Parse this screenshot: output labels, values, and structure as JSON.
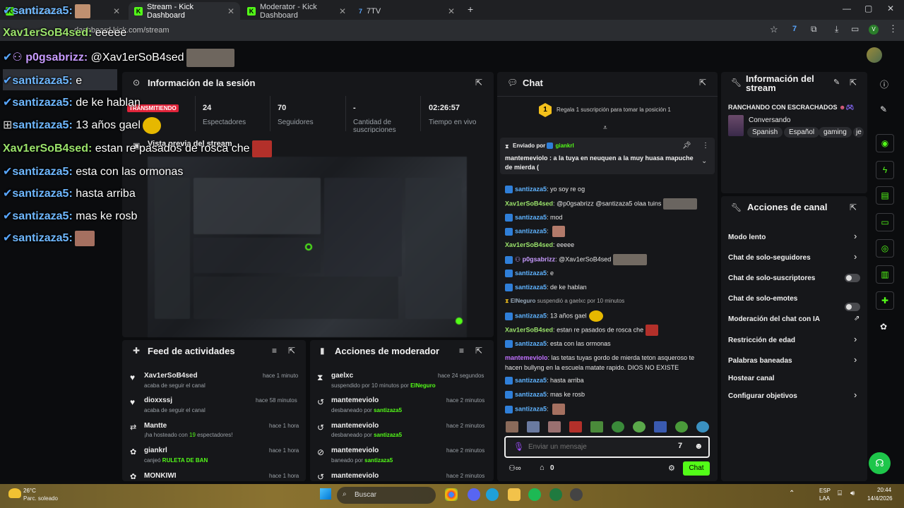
{
  "browser": {
    "tabs": [
      {
        "label": "santizaza5: ..."
      },
      {
        "label": "Stream - Kick Dashboard"
      },
      {
        "label": "Moderator - Kick Dashboard"
      },
      {
        "label": "7TV"
      }
    ],
    "url": "dashboard.kick.com/stream",
    "profile_initial": "V"
  },
  "overlay_chat": [
    {
      "user": "santizaza5:",
      "text": ""
    },
    {
      "user": "Xav1erSoB4sed:",
      "text": "eeeee"
    },
    {
      "user": "p0gsabrizz:",
      "text": "@Xav1erSoB4sed"
    },
    {
      "user": "santizaza5:",
      "text": "e"
    },
    {
      "user": "santizaza5:",
      "text": "de ke hablan"
    },
    {
      "user": "santizaza5:",
      "text": "13 años gael"
    },
    {
      "user": "Xav1erSoB4sed:",
      "text": "estan re pasados de rosca che"
    },
    {
      "user": "santizaza5:",
      "text": "esta con las ormonas"
    },
    {
      "user": "santizaza5:",
      "text": "hasta arriba"
    },
    {
      "user": "santizaza5:",
      "text": "mas ke rosb"
    },
    {
      "user": "santizaza5:",
      "text": ""
    }
  ],
  "session": {
    "title": "Información de la sesión",
    "live_badge": "TRANSMITIENDO",
    "stats": [
      {
        "value": "24",
        "label": "Espectadores"
      },
      {
        "value": "70",
        "label": "Seguidores"
      },
      {
        "value": "-",
        "label": "Cantidad de suscripciones"
      },
      {
        "value": "02:26:57",
        "label": "Tiempo en vivo"
      }
    ],
    "preview_title": "Vista previa del stream"
  },
  "activity": {
    "title": "Feed de actividades",
    "items": [
      {
        "name": "Xav1erSoB4sed",
        "sub": "acaba de seguir el canal",
        "time": "hace 1 minuto"
      },
      {
        "name": "dioxxssj",
        "sub": "acaba de seguir el canal",
        "time": "hace 58 minutos"
      },
      {
        "name": "Mantte",
        "sub_pre": "¡ha hosteado con ",
        "sub_hl": "19",
        "sub_post": " espectadores!",
        "time": "hace 1 hora"
      },
      {
        "name": "giankrl",
        "sub_pre": "canjeó ",
        "sub_hl": "RULETA DE BAN",
        "time": "hace 1 hora"
      },
      {
        "name": "MONKIWI",
        "time": "hace 1 hora"
      }
    ]
  },
  "modactions": {
    "title": "Acciones de moderador",
    "items": [
      {
        "name": "gaelxc",
        "sub_pre": "suspendido por 10 minutos por ",
        "sub_hl": "ElNeguro",
        "time": "hace 24 segundos"
      },
      {
        "name": "mantemeviolo",
        "sub_pre": "desbaneado por ",
        "sub_hl": "santizaza5",
        "time": "hace 2 minutos"
      },
      {
        "name": "mantemeviolo",
        "sub_pre": "desbaneado por ",
        "sub_hl": "santizaza5",
        "time": "hace 2 minutos"
      },
      {
        "name": "mantemeviolo",
        "sub_pre": "baneado por ",
        "sub_hl": "santizaza5",
        "time": "hace 2 minutos"
      },
      {
        "name": "mantemeviolo",
        "time": "hace 2 minutos"
      }
    ]
  },
  "chat": {
    "title": "Chat",
    "gift_text": "Regala 1 suscripción para tomar la posición 1",
    "gift_rank": "1",
    "pinned_label": "Enviado por",
    "pinned_user": "giankrl",
    "pinned_text": "mantemeviolo : a la tuya en neuquen a la muy huasa mapuche de mierda (",
    "messages": [
      {
        "user": "santizaza5",
        "text": "yo soy re og"
      },
      {
        "user": "Xav1erSoB4sed",
        "text": "@p0gsabrizz @santizaza5 olaa tuins"
      },
      {
        "user": "santizaza5",
        "text": "mod"
      },
      {
        "user": "santizaza5",
        "text": ""
      },
      {
        "user": "Xav1erSoB4sed",
        "text": "eeeee"
      },
      {
        "user": "p0gsabrizz",
        "text": "@Xav1erSoB4sed"
      },
      {
        "user": "santizaza5",
        "text": "e"
      },
      {
        "user": "santizaza5",
        "text": "de ke hablan"
      },
      {
        "user": "ElNeguro",
        "text": "suspendió a gaelxc por 10 minutos"
      },
      {
        "user": "santizaza5",
        "text": "13 años gael"
      },
      {
        "user": "Xav1erSoB4sed",
        "text": "estan re pasados de rosca che"
      },
      {
        "user": "santizaza5",
        "text": "esta con las ormonas"
      },
      {
        "user": "mantemeviolo",
        "text": "las tetas tuyas gordo de mierda teton asqueroso te hacen bullyng en la escuela matate rapido. DIOS NO EXISTE"
      },
      {
        "user": "santizaza5",
        "text": "hasta arriba"
      },
      {
        "user": "santizaza5",
        "text": "mas ke rosb"
      },
      {
        "user": "santizaza5",
        "text": ""
      }
    ],
    "input_placeholder": "Enviar un mensaje",
    "viewers_count": "0",
    "send_label": "Chat"
  },
  "stream_info": {
    "title": "Información del stream",
    "stream_title": "RANCHANDO CON ESCRACHADOS",
    "category": "Conversando",
    "tags": [
      "Spanish",
      "Español",
      "gaming",
      "je"
    ]
  },
  "channel_actions": {
    "title": "Acciones de canal",
    "items": [
      {
        "label": "Modo lento",
        "control": "chevron"
      },
      {
        "label": "Chat de solo-seguidores",
        "control": "chevron"
      },
      {
        "label": "Chat de solo-suscriptores",
        "control": "toggle"
      },
      {
        "label": "Chat de solo-emotes",
        "control": "toggle"
      },
      {
        "label": "Moderación del chat con IA",
        "control": "external"
      },
      {
        "label": "Restricción de edad",
        "control": "chevron"
      },
      {
        "label": "Palabras baneadas",
        "control": "chevron"
      },
      {
        "label": "Hostear canal",
        "control": "none"
      },
      {
        "label": "Configurar objetivos",
        "control": "chevron"
      }
    ]
  },
  "taskbar": {
    "weather_temp": "26°C",
    "weather_desc": "Parc. soleado",
    "search": "Buscar",
    "lang": "ESP",
    "lang2": "LAA",
    "time": "20:44",
    "date": "14/4/2026"
  },
  "colors": {
    "accent": "#53fc18",
    "panel": "#16171a",
    "live": "#e0243a"
  }
}
